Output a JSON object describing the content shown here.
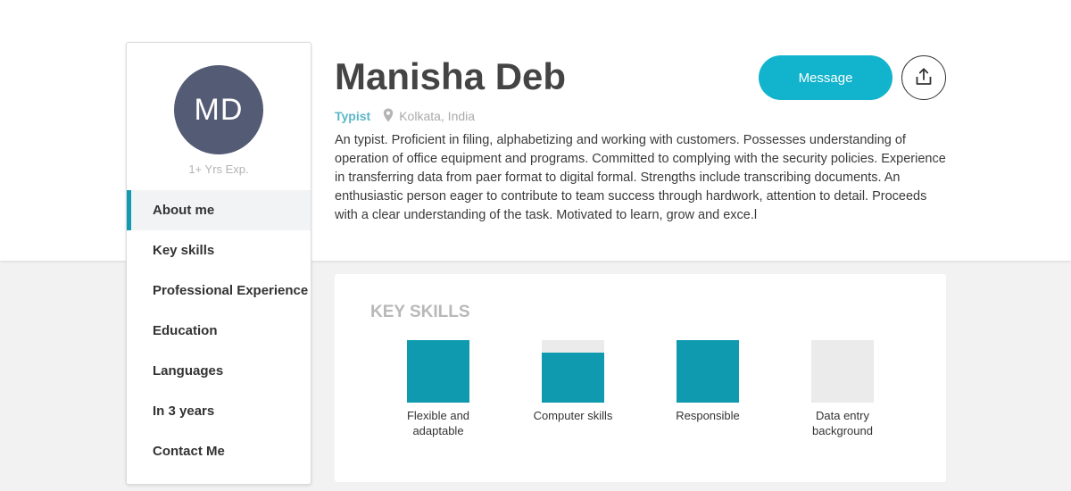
{
  "profile": {
    "initials": "MD",
    "experience": "1+ Yrs Exp.",
    "name": "Manisha Deb",
    "role": "Typist",
    "location": "Kolkata, India",
    "about": "An typist. Proficient in filing, alphabetizing and working with customers. Possesses understanding of operation of office equipment and programs. Committed to complying with the security policies. Experience in transferring data from paer format to digital formal. Strengths include transcribing documents. An enthusiastic person eager to contribute to team success through hardwork, attention to detail. Proceeds with a clear understanding of the task. Motivated to learn, grow and exce.l"
  },
  "actions": {
    "message_label": "Message",
    "share_icon": "share-upload-icon"
  },
  "sidebar": {
    "items": [
      {
        "label": "About me",
        "active": true
      },
      {
        "label": "Key skills",
        "active": false
      },
      {
        "label": "Professional Experience",
        "active": false
      },
      {
        "label": "Education",
        "active": false
      },
      {
        "label": "Languages",
        "active": false
      },
      {
        "label": "In 3 years",
        "active": false
      },
      {
        "label": "Contact Me",
        "active": false
      }
    ]
  },
  "skills": {
    "title": "KEY SKILLS",
    "items": [
      {
        "label": "Flexible and adaptable",
        "level": 1.0
      },
      {
        "label": "Computer skills",
        "level": 0.8
      },
      {
        "label": "Responsible",
        "level": 1.0
      },
      {
        "label": "Data entry background",
        "level": 0.0
      }
    ]
  },
  "colors": {
    "accent": "#12b3cd",
    "skill_fill": "#0f9aaf",
    "skill_empty": "#ebebeb",
    "avatar_bg": "#545b75",
    "role_text": "#5bb7c9"
  },
  "icons": {
    "location": "map-pin-icon",
    "share": "share-upload-icon"
  }
}
